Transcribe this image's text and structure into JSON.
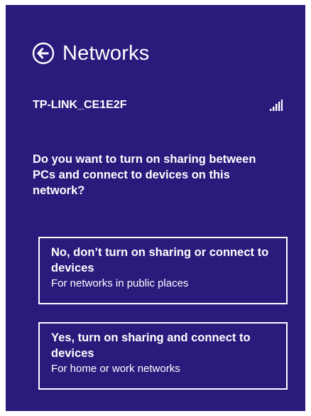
{
  "panel": {
    "background": "#2a1a7c",
    "title": "Networks",
    "back_icon": "back-arrow-circle-icon"
  },
  "network": {
    "name": "TP-LINK_CE1E2F",
    "signal_icon": "wifi-signal-bars-icon",
    "signal_strength_bars": 4
  },
  "question": "Do you want to turn on sharing between PCs and connect to devices on this network?",
  "options": [
    {
      "title": "No, don’t turn on sharing or connect to devices",
      "subtitle": "For networks in public places"
    },
    {
      "title": "Yes, turn on sharing and connect to devices",
      "subtitle": "For home or work networks"
    }
  ]
}
